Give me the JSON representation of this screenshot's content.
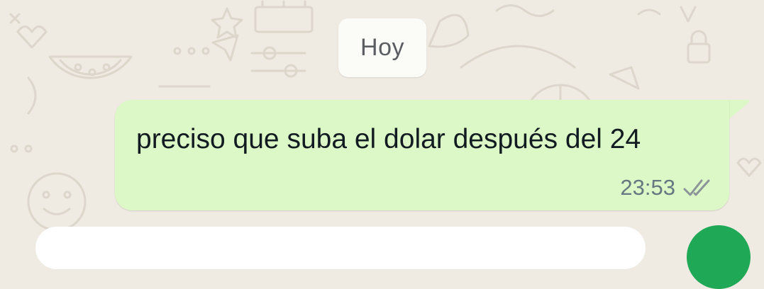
{
  "chat": {
    "date_chip": "Hoy",
    "messages": [
      {
        "direction": "outgoing",
        "text": "preciso que suba el dolar después del 24",
        "time": "23:53",
        "status_icon": "double-check-icon"
      }
    ]
  },
  "colors": {
    "wallpaper": "#efeae2",
    "outgoing_bubble": "#dcf8c6",
    "date_chip": "#fbfbf8",
    "send_button": "#1fa855"
  }
}
